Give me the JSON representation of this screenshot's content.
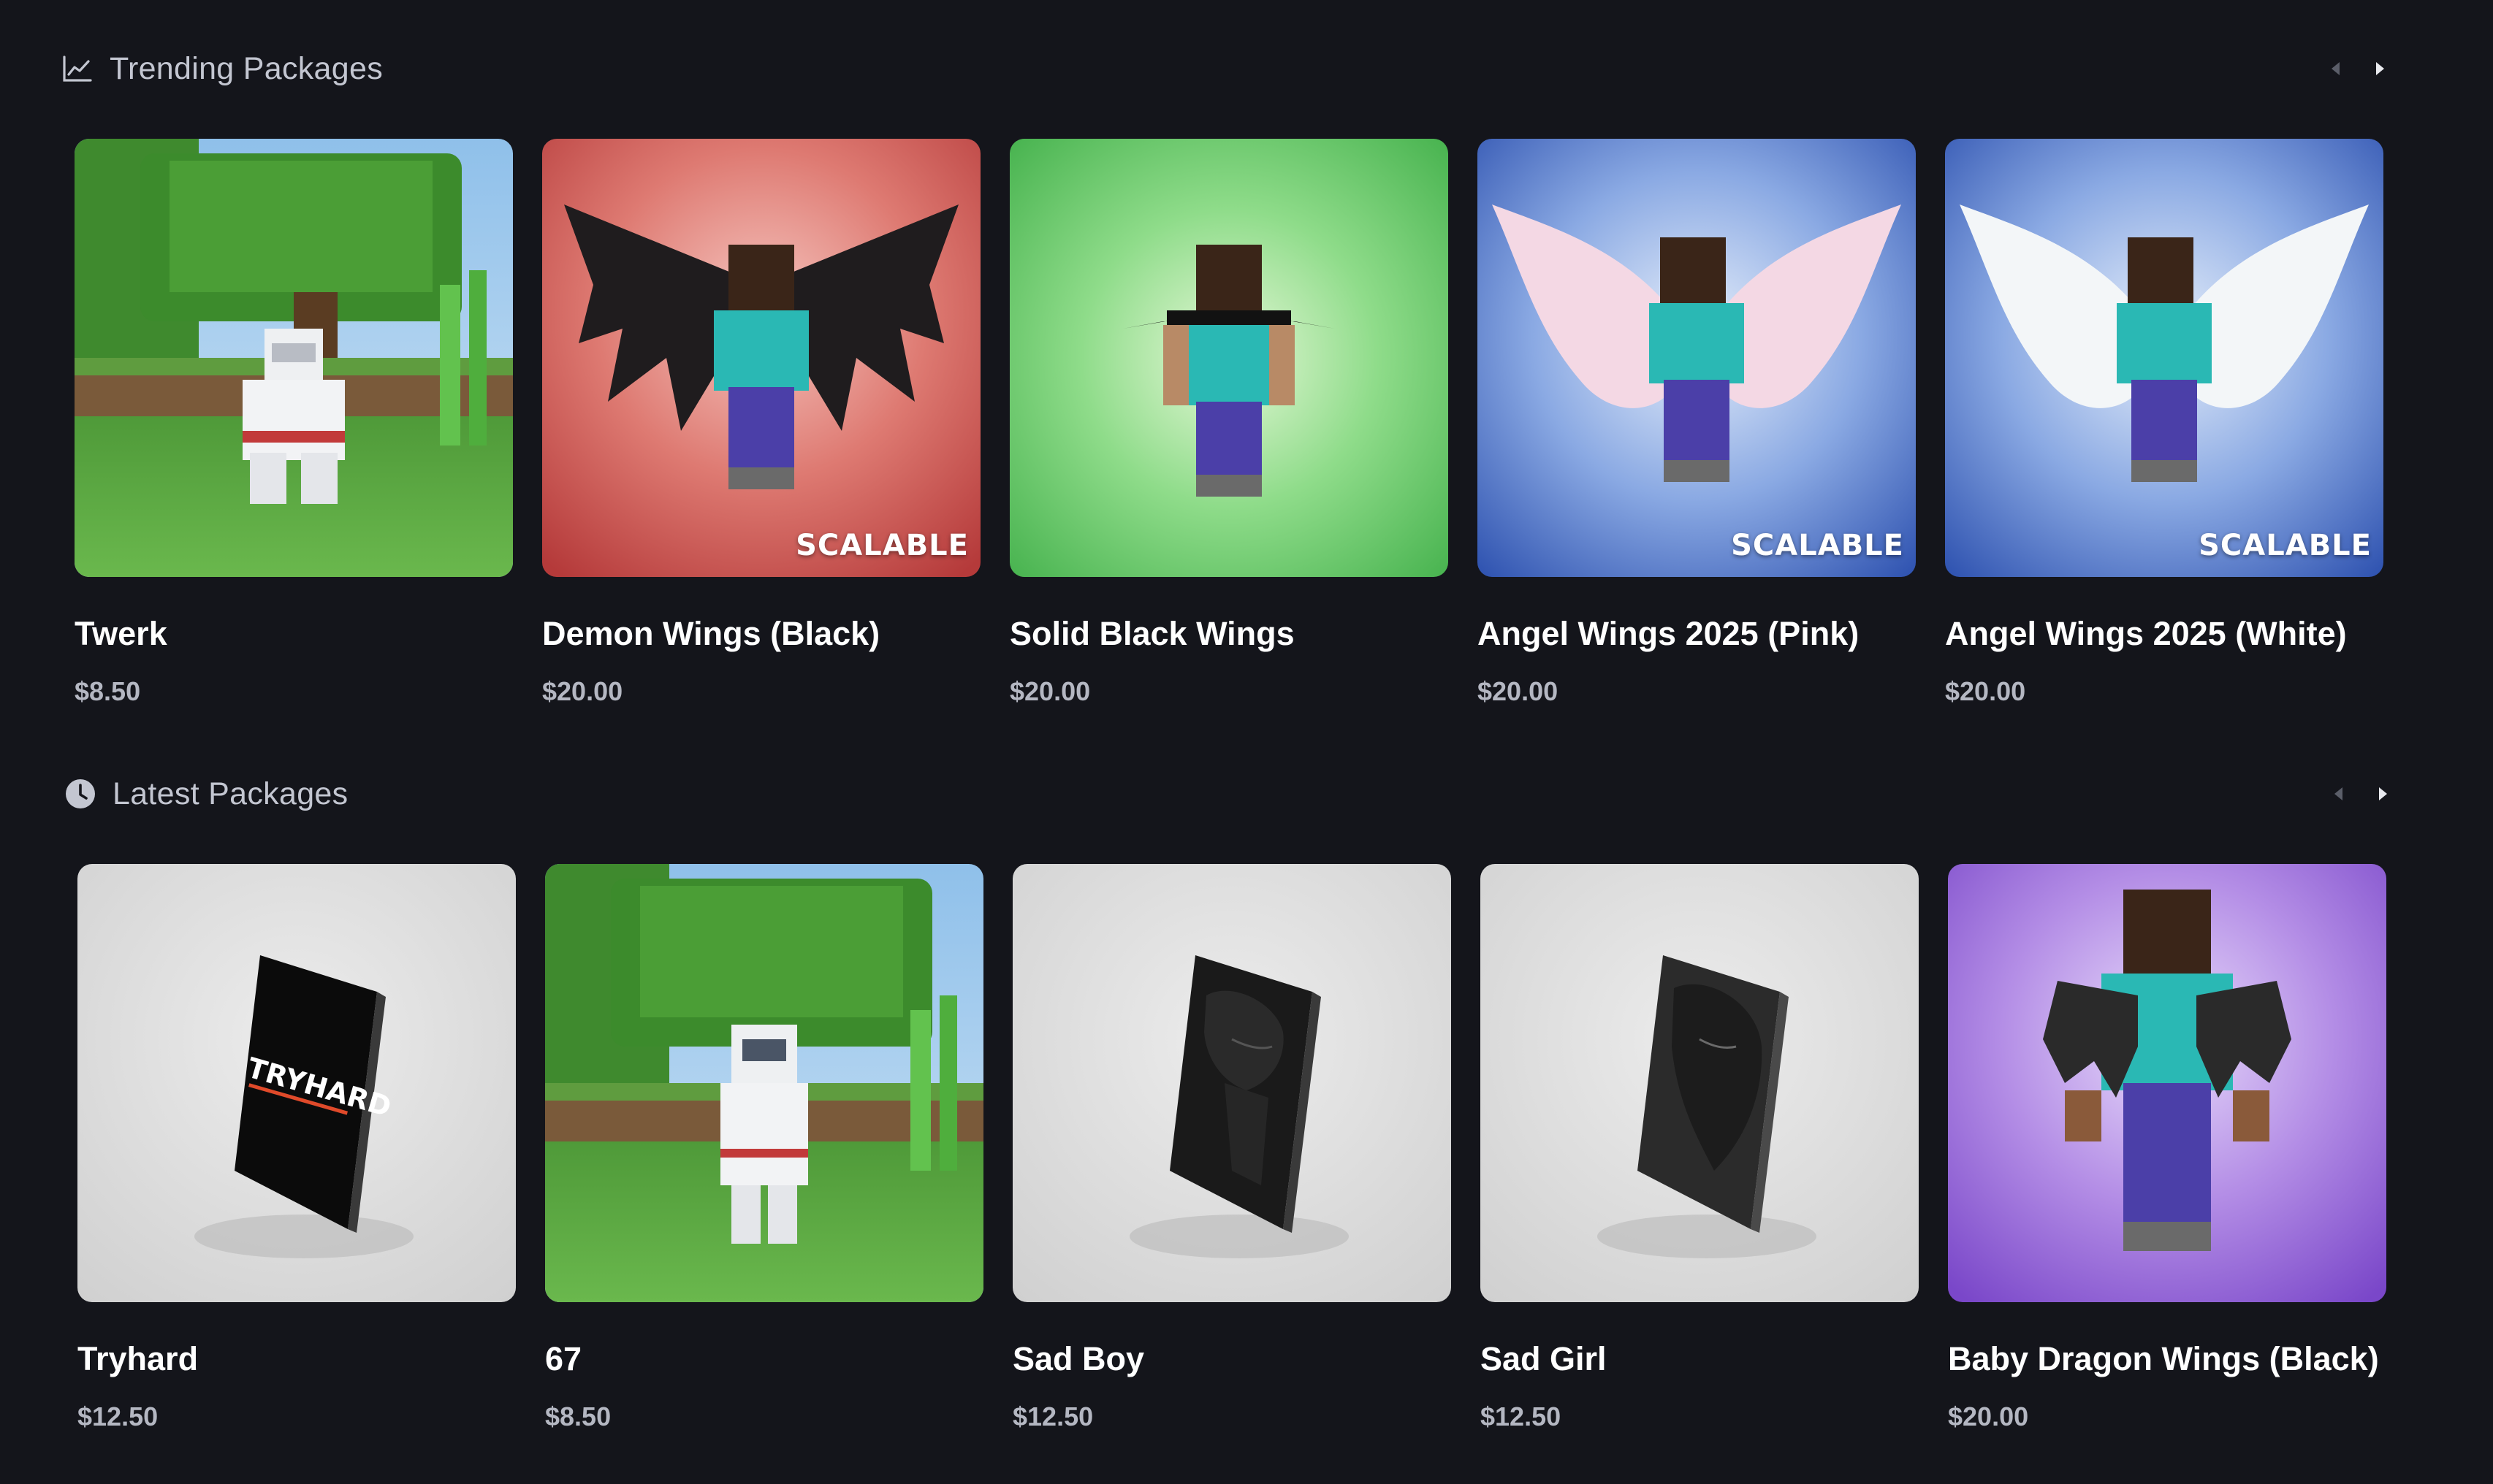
{
  "trending": {
    "title": "Trending Packages",
    "icon": "trending-chart-icon",
    "packages": [
      {
        "name": "Twerk",
        "price": "$8.50",
        "badge": "",
        "thumbnail": "minecraft-scene"
      },
      {
        "name": "Demon Wings (Black)",
        "price": "$20.00",
        "badge": "SCALABLE",
        "thumbnail": "demon-wings"
      },
      {
        "name": "Solid Black Wings",
        "price": "$20.00",
        "badge": "",
        "thumbnail": "solid-black-wings"
      },
      {
        "name": "Angel Wings 2025 (Pink)",
        "price": "$20.00",
        "badge": "SCALABLE",
        "thumbnail": "angel-wings-pink"
      },
      {
        "name": "Angel Wings 2025 (White)",
        "price": "$20.00",
        "badge": "SCALABLE",
        "thumbnail": "angel-wings-white"
      }
    ]
  },
  "latest": {
    "title": "Latest Packages",
    "icon": "clock-icon",
    "packages": [
      {
        "name": "Tryhard",
        "price": "$12.50",
        "badge": "",
        "thumbnail": "cape-tryhard",
        "cape_text": "TRYHARD"
      },
      {
        "name": "67",
        "price": "$8.50",
        "badge": "",
        "thumbnail": "minecraft-scene-astronaut"
      },
      {
        "name": "Sad Boy",
        "price": "$12.50",
        "badge": "",
        "thumbnail": "cape-sad-boy"
      },
      {
        "name": "Sad Girl",
        "price": "$12.50",
        "badge": "",
        "thumbnail": "cape-sad-girl"
      },
      {
        "name": "Baby Dragon Wings (Black)",
        "price": "$20.00",
        "badge": "",
        "thumbnail": "baby-dragon-wings"
      }
    ]
  },
  "colors": {
    "background": "#14151b",
    "section_title": "#c3c6d1",
    "price": "#b4b7c2",
    "nav_arrow_dim": "#5b5e69",
    "nav_arrow_active": "#e8e9ee"
  }
}
